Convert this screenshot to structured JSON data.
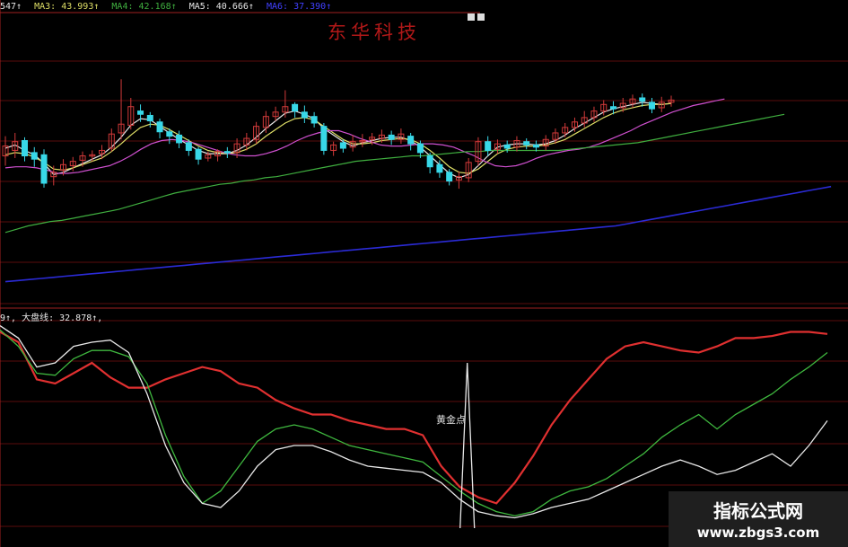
{
  "legend": {
    "ma2": "547↑",
    "ma3": "MA3: 43.993↑",
    "ma4": "MA4: 42.168↑",
    "ma5": "MA5: 40.666↑",
    "ma6": "MA6: 37.390↑"
  },
  "stock_title": "东华科技",
  "indicator_legend": "9↑, 大盘线: 32.878↑,",
  "annotation": "黄金点",
  "watermark": {
    "line1": "指标公式网",
    "line2": "www.zbgs3.com"
  },
  "colors": {
    "background": "#000000",
    "candle_up": "#d23a3a",
    "candle_down": "#38d8e8",
    "ma_white": "#e6e6e6",
    "ma_yellow": "#dede66",
    "ma_magenta": "#d050d0",
    "ma_green": "#3fae3f",
    "ma_long": "#c8c8c0",
    "ma_blue": "#2b2bd6",
    "red_line": "#e03030",
    "green_line": "#3fb83f",
    "white_line": "#e8e8e8",
    "grid": "#5a0c0c"
  },
  "chart_data": [
    {
      "type": "candlestick",
      "title": "东华科技",
      "candles": [
        [
          40.5,
          41.4,
          39.6,
          42.3
        ],
        [
          41.0,
          41.8,
          40.3,
          42.6
        ],
        [
          41.9,
          40.5,
          40.0,
          42.2
        ],
        [
          40.8,
          40.2,
          39.5,
          41.3
        ],
        [
          40.6,
          38.0,
          37.6,
          41.1
        ],
        [
          38.6,
          39.0,
          37.8,
          39.6
        ],
        [
          39.2,
          39.7,
          38.7,
          40.2
        ],
        [
          39.6,
          40.0,
          39.1,
          40.4
        ],
        [
          40.1,
          40.5,
          39.5,
          40.9
        ],
        [
          40.5,
          40.6,
          40.0,
          41.0
        ],
        [
          40.7,
          41.0,
          40.2,
          41.5
        ],
        [
          41.2,
          42.5,
          40.9,
          43.0
        ],
        [
          42.6,
          43.4,
          42.0,
          47.5
        ],
        [
          43.3,
          45.0,
          42.9,
          45.8
        ],
        [
          44.6,
          44.3,
          43.6,
          45.2
        ],
        [
          44.2,
          43.7,
          43.1,
          44.5
        ],
        [
          43.6,
          42.7,
          42.1,
          43.9
        ],
        [
          42.7,
          42.3,
          41.6,
          43.0
        ],
        [
          42.4,
          41.7,
          41.2,
          42.8
        ],
        [
          41.7,
          41.0,
          40.5,
          42.0
        ],
        [
          41.1,
          40.2,
          39.7,
          41.3
        ],
        [
          40.3,
          40.6,
          40.0,
          40.9
        ],
        [
          40.5,
          40.9,
          40.0,
          41.1
        ],
        [
          40.9,
          40.8,
          40.3,
          41.3
        ],
        [
          40.8,
          41.6,
          40.3,
          42.1
        ],
        [
          41.5,
          42.1,
          41.0,
          42.6
        ],
        [
          42.0,
          43.2,
          41.6,
          43.6
        ],
        [
          43.1,
          44.1,
          42.6,
          44.6
        ],
        [
          44.1,
          44.5,
          43.7,
          45.0
        ],
        [
          44.5,
          45.0,
          44.0,
          46.5
        ],
        [
          45.2,
          44.6,
          44.0,
          45.4
        ],
        [
          44.5,
          44.0,
          43.5,
          45.1
        ],
        [
          44.1,
          43.5,
          43.1,
          44.5
        ],
        [
          43.2,
          41.0,
          40.6,
          43.5
        ],
        [
          41.0,
          41.5,
          40.5,
          41.8
        ],
        [
          41.7,
          41.2,
          40.8,
          42.0
        ],
        [
          41.3,
          41.8,
          40.9,
          42.4
        ],
        [
          41.8,
          41.9,
          41.3,
          42.5
        ],
        [
          42.0,
          42.2,
          41.5,
          42.6
        ],
        [
          42.1,
          42.4,
          41.7,
          42.9
        ],
        [
          42.4,
          42.0,
          41.5,
          42.8
        ],
        [
          42.0,
          42.5,
          41.6,
          43.0
        ],
        [
          42.3,
          41.6,
          41.0,
          42.6
        ],
        [
          41.6,
          40.8,
          40.3,
          41.9
        ],
        [
          40.5,
          39.5,
          38.9,
          40.8
        ],
        [
          39.7,
          39.0,
          38.5,
          40.1
        ],
        [
          39.0,
          38.2,
          37.8,
          39.3
        ],
        [
          38.3,
          38.6,
          37.5,
          39.1
        ],
        [
          38.5,
          39.9,
          38.1,
          40.3
        ],
        [
          40.0,
          41.8,
          39.6,
          42.2
        ],
        [
          41.8,
          41.0,
          40.5,
          42.3
        ],
        [
          41.1,
          41.6,
          40.7,
          42.0
        ],
        [
          41.5,
          41.2,
          40.8,
          41.9
        ],
        [
          41.3,
          41.9,
          40.9,
          42.3
        ],
        [
          41.8,
          41.5,
          41.1,
          42.1
        ],
        [
          41.5,
          41.3,
          40.9,
          41.9
        ],
        [
          41.4,
          42.0,
          41.0,
          42.4
        ],
        [
          42.0,
          42.6,
          41.6,
          43.0
        ],
        [
          42.6,
          43.1,
          42.2,
          43.5
        ],
        [
          43.1,
          43.6,
          42.7,
          44.0
        ],
        [
          43.5,
          44.0,
          43.1,
          44.6
        ],
        [
          44.0,
          44.6,
          43.6,
          45.0
        ],
        [
          44.6,
          45.2,
          44.2,
          45.6
        ],
        [
          45.0,
          44.8,
          44.3,
          45.5
        ],
        [
          44.9,
          45.3,
          44.5,
          45.8
        ],
        [
          45.3,
          45.7,
          44.9,
          46.1
        ],
        [
          45.8,
          45.5,
          45.0,
          46.2
        ],
        [
          45.4,
          44.8,
          44.4,
          45.8
        ],
        [
          44.9,
          45.4,
          44.5,
          45.9
        ],
        [
          45.4,
          45.6,
          45.0,
          46.0
        ]
      ],
      "moving_averages": [
        {
          "name": "MA3",
          "values": [
            41.2,
            41.5,
            41.0,
            40.6,
            39.8,
            38.8,
            39.0,
            39.4,
            39.8,
            40.2,
            40.6,
            41.3,
            42.2,
            43.3,
            43.9,
            43.8,
            43.2,
            42.6,
            42.0,
            41.5,
            41.0,
            40.7,
            40.7,
            40.7,
            41.0,
            41.5,
            42.2,
            43.0,
            43.7,
            44.4,
            44.6,
            44.3,
            43.9,
            43.0,
            42.4,
            41.8,
            41.4,
            41.7,
            41.9,
            42.1,
            42.2,
            42.2,
            41.9,
            41.3,
            40.5,
            39.7,
            38.9,
            38.5,
            38.8,
            39.6,
            40.5,
            41.3,
            41.5,
            41.6,
            41.6,
            41.5,
            41.6,
            41.9,
            42.4,
            43.0,
            43.5,
            44.0,
            44.5,
            44.8,
            45.0,
            45.2,
            45.4,
            45.3,
            45.2,
            45.3
          ]
        },
        {
          "name": "MA4",
          "values": [
            40.6,
            40.8,
            40.7,
            40.4,
            39.9,
            39.3,
            39.2,
            39.4,
            39.7,
            40.0,
            40.3,
            40.9,
            41.6,
            42.4,
            43.1,
            43.4,
            43.3,
            42.9,
            42.4,
            41.9,
            41.4,
            41.0,
            40.8,
            40.7,
            40.8,
            41.1,
            41.6,
            42.3,
            42.9,
            43.5,
            43.9,
            44.0,
            43.8,
            43.2,
            42.6,
            42.0,
            41.6,
            41.6,
            41.7,
            41.9,
            42.0,
            42.1,
            42.0,
            41.6,
            41.0,
            40.3,
            39.5,
            39.0,
            38.9,
            39.3,
            40.0,
            40.7,
            41.1,
            41.3,
            41.4,
            41.4,
            41.5,
            41.7,
            42.0,
            42.5,
            43.0,
            43.5,
            44.0,
            44.4,
            44.7,
            44.9,
            45.1,
            45.2,
            45.2,
            45.3
          ]
        },
        {
          "name": "MA5",
          "values": [
            39.4,
            39.5,
            39.5,
            39.4,
            39.2,
            38.9,
            38.9,
            39.0,
            39.2,
            39.4,
            39.6,
            40.0,
            40.5,
            41.1,
            41.6,
            41.9,
            42.0,
            41.9,
            41.7,
            41.4,
            41.1,
            40.8,
            40.6,
            40.5,
            40.5,
            40.7,
            41.0,
            41.4,
            41.9,
            42.3,
            42.6,
            42.8,
            42.8,
            42.5,
            42.1,
            41.8,
            41.5,
            41.4,
            41.4,
            41.5,
            41.6,
            41.6,
            41.5,
            41.3,
            40.9,
            40.5,
            40.0,
            39.6,
            39.5,
            39.6,
            39.9,
            40.3,
            40.6,
            40.8,
            41.0,
            41.1,
            41.3,
            41.6,
            42.0,
            42.4,
            42.8,
            43.3,
            43.7,
            44.1,
            44.5,
            44.8,
            45.1,
            45.3,
            45.5,
            45.7
          ]
        },
        {
          "name": "MA6",
          "values": [
            33.5,
            33.8,
            34.1,
            34.3,
            34.5,
            34.6,
            34.8,
            35.0,
            35.2,
            35.4,
            35.6,
            35.9,
            36.2,
            36.5,
            36.8,
            37.1,
            37.3,
            37.5,
            37.7,
            37.9,
            38.0,
            38.2,
            38.3,
            38.5,
            38.6,
            38.8,
            39.0,
            39.2,
            39.4,
            39.6,
            39.8,
            40.0,
            40.1,
            40.2,
            40.3,
            40.4,
            40.5,
            40.5,
            40.6,
            40.7,
            40.8,
            40.9,
            40.9,
            41.0,
            41.0,
            41.0,
            41.0,
            41.0,
            41.0,
            41.0,
            41.1,
            41.2,
            41.3,
            41.4,
            41.5,
            41.6,
            41.7,
            41.9,
            42.1,
            42.3,
            42.5,
            42.7,
            42.9,
            43.1,
            43.3,
            43.5,
            43.7,
            43.9,
            44.1,
            44.3
          ]
        },
        {
          "name": "MA7",
          "values": [
            29.0,
            29.1,
            29.2,
            29.3,
            29.4,
            29.5,
            29.6,
            29.7,
            29.8,
            29.9,
            30.0,
            30.1,
            30.2,
            30.3,
            30.4,
            30.5,
            30.6,
            30.7,
            30.8,
            30.9,
            31.0,
            31.1,
            31.2,
            31.3,
            31.4,
            31.5,
            31.6,
            31.7,
            31.8,
            31.9,
            32.0,
            32.1,
            32.2,
            32.3,
            32.4,
            32.5,
            32.6,
            32.7,
            32.8,
            32.9,
            33.0,
            33.1,
            33.2,
            33.3,
            33.4,
            33.5,
            33.6,
            33.7,
            33.8,
            33.9,
            34.0,
            34.1,
            34.3,
            34.5,
            34.7,
            34.9,
            35.1,
            35.3,
            35.5,
            35.7,
            35.9,
            36.1,
            36.3,
            36.5,
            36.7,
            36.9,
            37.1,
            37.3,
            37.5,
            37.7
          ]
        }
      ],
      "ylim": [
        27,
        49
      ]
    },
    {
      "type": "line",
      "ylim": [
        0,
        100
      ],
      "series": [
        {
          "name": "大盘线",
          "values": [
            95,
            90,
            72,
            70,
            75,
            80,
            73,
            68,
            68,
            72,
            75,
            78,
            76,
            70,
            68,
            62,
            58,
            55,
            55,
            52,
            50,
            48,
            48,
            45,
            30,
            20,
            15,
            12,
            22,
            35,
            50,
            62,
            72,
            82,
            88,
            90,
            88,
            86,
            85,
            88,
            92,
            92,
            93,
            95,
            95,
            94
          ]
        },
        {
          "values": [
            96,
            88,
            75,
            74,
            82,
            86,
            86,
            83,
            70,
            45,
            25,
            12,
            18,
            30,
            42,
            48,
            50,
            48,
            44,
            40,
            38,
            36,
            34,
            32,
            25,
            18,
            12,
            8,
            6,
            8,
            14,
            18,
            20,
            24,
            30,
            36,
            44,
            50,
            55,
            48,
            55,
            60,
            65,
            72,
            78,
            85
          ]
        },
        {
          "values": [
            98,
            92,
            78,
            80,
            88,
            90,
            91,
            85,
            65,
            40,
            22,
            12,
            10,
            18,
            30,
            38,
            40,
            40,
            37,
            33,
            30,
            29,
            28,
            27,
            22,
            14,
            8,
            6,
            5,
            7,
            10,
            12,
            14,
            18,
            22,
            26,
            30,
            33,
            30,
            26,
            28,
            32,
            36,
            30,
            40,
            52
          ]
        },
        {
          "values": [
            0,
            0,
            0,
            0,
            0,
            0,
            0,
            0,
            0,
            0,
            0,
            0,
            0,
            0,
            0,
            0,
            0,
            0,
            0,
            0,
            0,
            0,
            0,
            0,
            0,
            0,
            0,
            0,
            0,
            0,
            0,
            0,
            0,
            0,
            0,
            0,
            0,
            0,
            0,
            0,
            0,
            0,
            0,
            0,
            0,
            0
          ]
        }
      ],
      "spike": {
        "at": 26,
        "value": 80
      }
    }
  ]
}
